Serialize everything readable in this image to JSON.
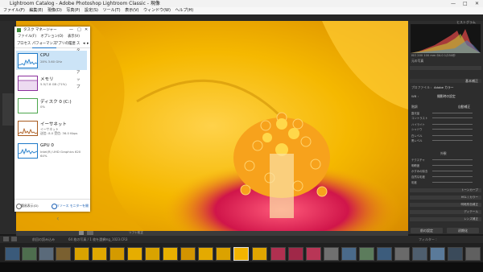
{
  "app": {
    "title": "Lightroom Catalog - Adobe Photoshop Lightroom Classic - 現像",
    "window_controls": [
      "—",
      "□",
      "✕"
    ]
  },
  "menubar": {
    "items": [
      "ファイル(F)",
      "編集(E)",
      "現像(D)",
      "写真(P)",
      "設定(S)",
      "ツール(T)",
      "表示(V)",
      "ウィンドウ(W)",
      "ヘルプ(H)"
    ]
  },
  "task_manager": {
    "title": "タスク マネージャー",
    "menu": [
      "ファイル(F)",
      "オプション(O)",
      "表示(V)"
    ],
    "tabs": [
      "プロセス",
      "パフォーマンス",
      "アプリの履歴",
      "スタートアップ"
    ],
    "active_tab": "パフォーマンス",
    "items": [
      {
        "name": "CPU",
        "sub": "28% 3.60 GHz",
        "sub2": "",
        "color": "#1e7ac8"
      },
      {
        "name": "メモリ",
        "sub": "5.5/7.8 GB (71%)",
        "sub2": "",
        "color": "#8b2e9c"
      },
      {
        "name": "ディスク 0 (C:)",
        "sub": "0%",
        "sub2": "",
        "color": "#4ca64c"
      },
      {
        "name": "イーサネット",
        "sub": "イーサネット",
        "sub2": "送信: 8.0 受信: 36.0 Kbps",
        "color": "#a85a1e"
      },
      {
        "name": "GPU 0",
        "sub": "Intel(R) UHD Graphics 620",
        "sub2": "64%",
        "color": "#1e7ac8"
      }
    ],
    "bottom": {
      "fewer_details": "簡易表示(D)",
      "resource_monitor": "リソース モニターを開く"
    }
  },
  "right_panel": {
    "histogram_title": "ヒストグラム",
    "histogram_readout": "ISO 200    100 mm    f/4.0    1/250秒",
    "original_photo": "元の写真",
    "basic": "基本補正",
    "profile_label": "プロファイル :",
    "profile_value": "Adobe カラー",
    "wb_label": "WB :",
    "wb_value": "撮影時の設定",
    "tone_label": "階調",
    "auto_label": "自動補正",
    "sliders": [
      "露光量",
      "コントラスト",
      "ハイライト",
      "シャドウ",
      "白レベル",
      "黒レベル"
    ],
    "presence_label": "外観",
    "presence_sliders": [
      "テクスチャ",
      "明瞭度",
      "かすみの除去",
      "自然な彩度",
      "彩度"
    ],
    "sections": [
      "トーンカーブ",
      "HSL / カラー",
      "明暗別色補正",
      "ディテール",
      "レンズ補正"
    ],
    "prev_button": "前の設定",
    "reset_button": "初期化"
  },
  "toolbar": {
    "soft_proof": "ソフト校正"
  },
  "filmstrip": {
    "source": "前回の読み込み",
    "count": "64 枚の写真 / 1 枚を選択",
    "filename": "/img_1023.CR3",
    "filter_label": "フィルター :"
  }
}
